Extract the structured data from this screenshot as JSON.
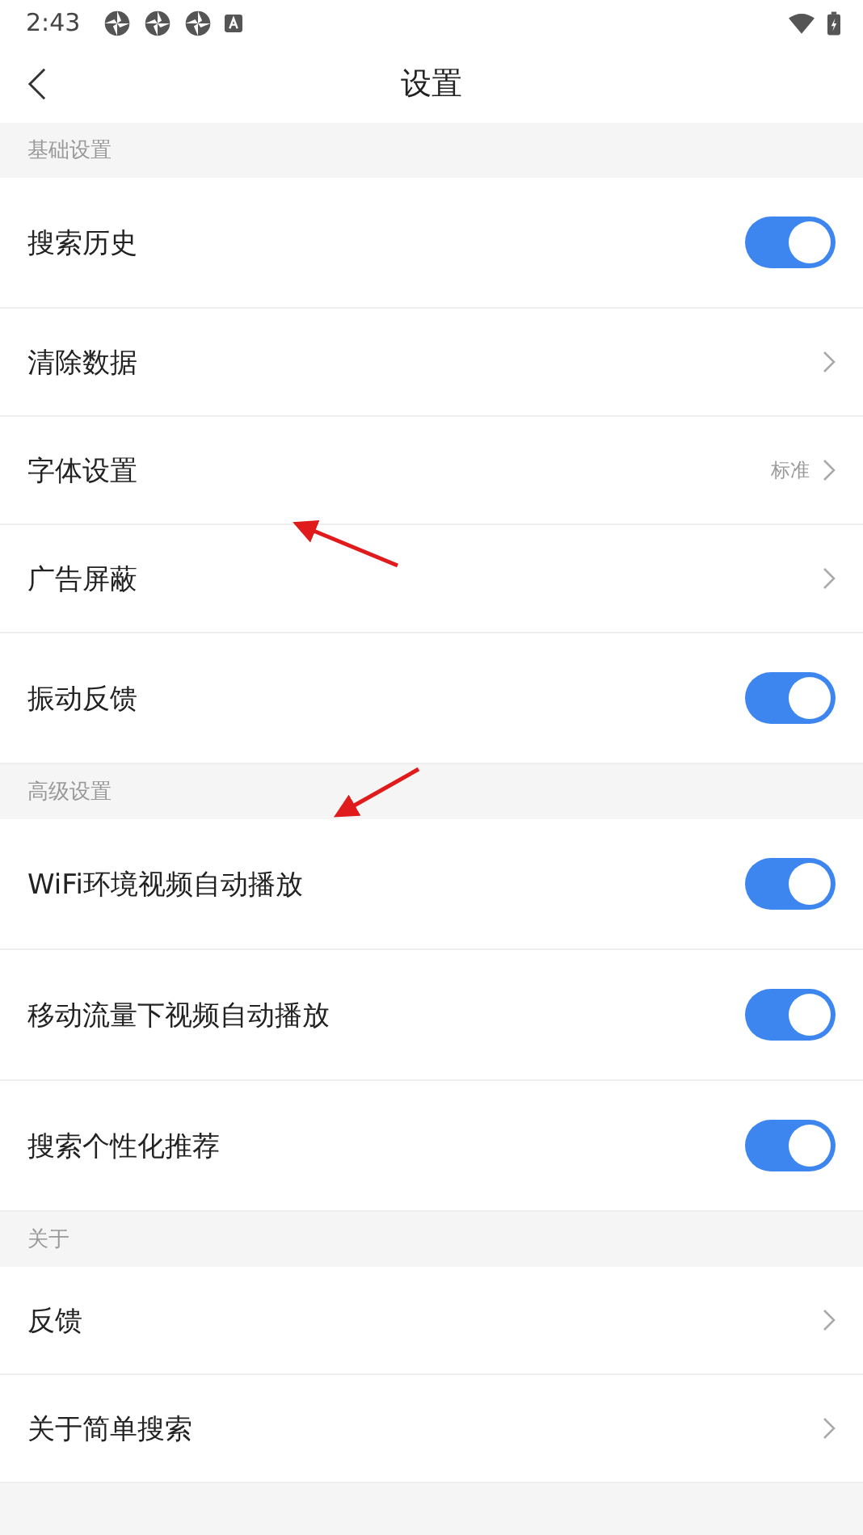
{
  "status_bar": {
    "time": "2:43",
    "notification_icons": [
      {
        "kind": "app"
      },
      {
        "kind": "app"
      },
      {
        "kind": "app"
      },
      {
        "kind": "letter"
      }
    ]
  },
  "header": {
    "title": "设置"
  },
  "sections": [
    {
      "title": "基础设置",
      "items": [
        {
          "kind": "toggle",
          "label": "搜索历史",
          "on": true
        },
        {
          "kind": "link",
          "label": "清除数据"
        },
        {
          "kind": "link",
          "label": "字体设置",
          "value": "标准"
        },
        {
          "kind": "link",
          "label": "广告屏蔽"
        },
        {
          "kind": "toggle",
          "label": "振动反馈",
          "on": true
        }
      ]
    },
    {
      "title": "高级设置",
      "items": [
        {
          "kind": "toggle",
          "label": "WiFi环境视频自动播放",
          "on": true
        },
        {
          "kind": "toggle",
          "label": "移动流量下视频自动播放",
          "on": true
        },
        {
          "kind": "toggle",
          "label": "搜索个性化推荐",
          "on": true
        }
      ]
    },
    {
      "title": "关于",
      "items": [
        {
          "kind": "link",
          "label": "反馈"
        },
        {
          "kind": "link",
          "label": "关于简单搜索"
        }
      ]
    }
  ],
  "annotations": [
    {
      "kind": "arrow"
    },
    {
      "kind": "arrow"
    }
  ]
}
